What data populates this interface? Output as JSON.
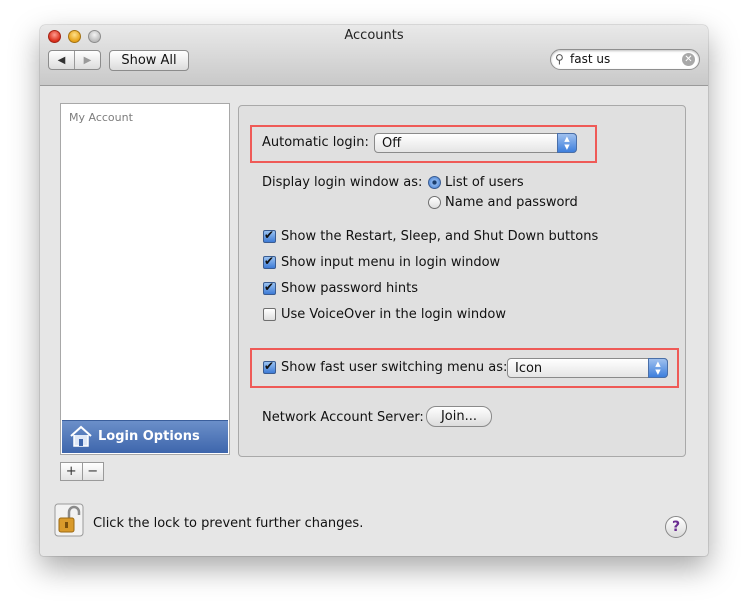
{
  "window": {
    "title": "Accounts"
  },
  "toolbar": {
    "back_icon": "◀",
    "forward_icon": "▶",
    "show_all_label": "Show All",
    "search_value": "fast us"
  },
  "sidebar": {
    "header": "My Account",
    "selected_item": "Login Options",
    "add_label": "+",
    "remove_label": "−"
  },
  "login_options": {
    "automatic_login_label": "Automatic login:",
    "automatic_login_value": "Off",
    "display_login_window_label": "Display login window as:",
    "display_options": [
      {
        "label": "List of users",
        "selected": true
      },
      {
        "label": "Name and password",
        "selected": false
      }
    ],
    "checkboxes": [
      {
        "label": "Show the Restart, Sleep, and Shut Down buttons",
        "checked": true
      },
      {
        "label": "Show input menu in login window",
        "checked": true
      },
      {
        "label": "Show password hints",
        "checked": true
      },
      {
        "label": "Use VoiceOver in the login window",
        "checked": false
      }
    ],
    "fast_switch_label": "Show fast user switching menu as:",
    "fast_switch_checked": true,
    "fast_switch_value": "Icon",
    "network_server_label": "Network Account Server:",
    "join_button_label": "Join..."
  },
  "footer": {
    "lock_text": "Click the lock to prevent further changes.",
    "help_label": "?"
  },
  "colors": {
    "highlight": "#ef5a57",
    "selection": "#4a72b8"
  }
}
